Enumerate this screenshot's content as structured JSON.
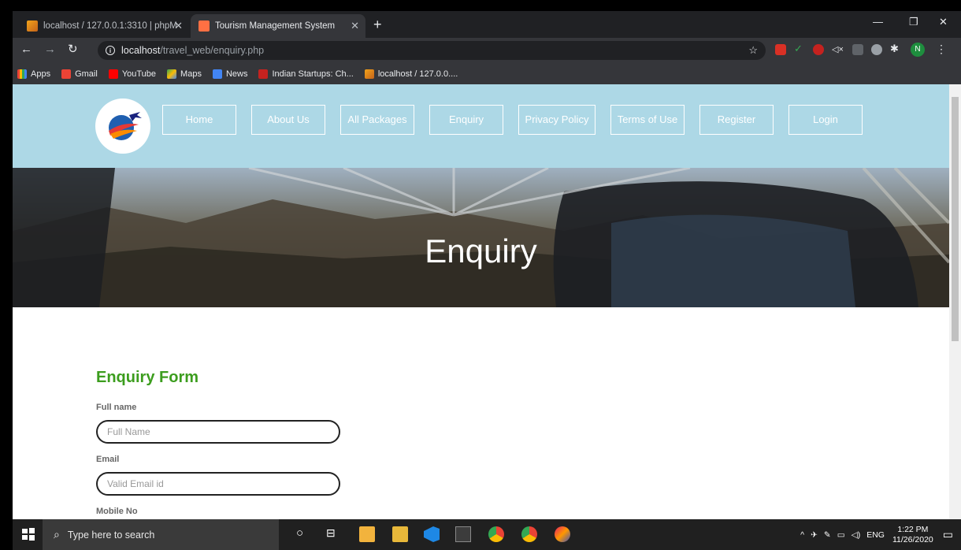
{
  "browser": {
    "tabs": [
      {
        "title": "localhost / 127.0.0.1:3310 | phpM",
        "active": false
      },
      {
        "title": "Tourism Management System",
        "active": true
      }
    ],
    "url_host": "localhost",
    "url_path": "/travel_web/enquiry.php",
    "bookmarks": [
      "Apps",
      "Gmail",
      "YouTube",
      "Maps",
      "News",
      "Indian Startups: Ch...",
      "localhost / 127.0.0...."
    ],
    "profile_initial": "N"
  },
  "site": {
    "nav": [
      "Home",
      "About Us",
      "All Packages",
      "Enquiry",
      "Privacy Policy",
      "Terms of Use",
      "Register",
      "Login"
    ],
    "hero_title": "Enquiry",
    "form": {
      "title": "Enquiry Form",
      "fullname_label": "Full name",
      "fullname_placeholder": "Full Name",
      "email_label": "Email",
      "email_placeholder": "Valid Email id",
      "mobile_label": "Mobile No"
    }
  },
  "taskbar": {
    "search_placeholder": "Type here to search",
    "lang": "ENG",
    "time": "1:22 PM",
    "date": "11/26/2020"
  },
  "colors": {
    "header_bg": "#add8e6",
    "form_title": "#3c9d1e",
    "chrome_dark": "#202124",
    "chrome_toolbar": "#35363a"
  }
}
